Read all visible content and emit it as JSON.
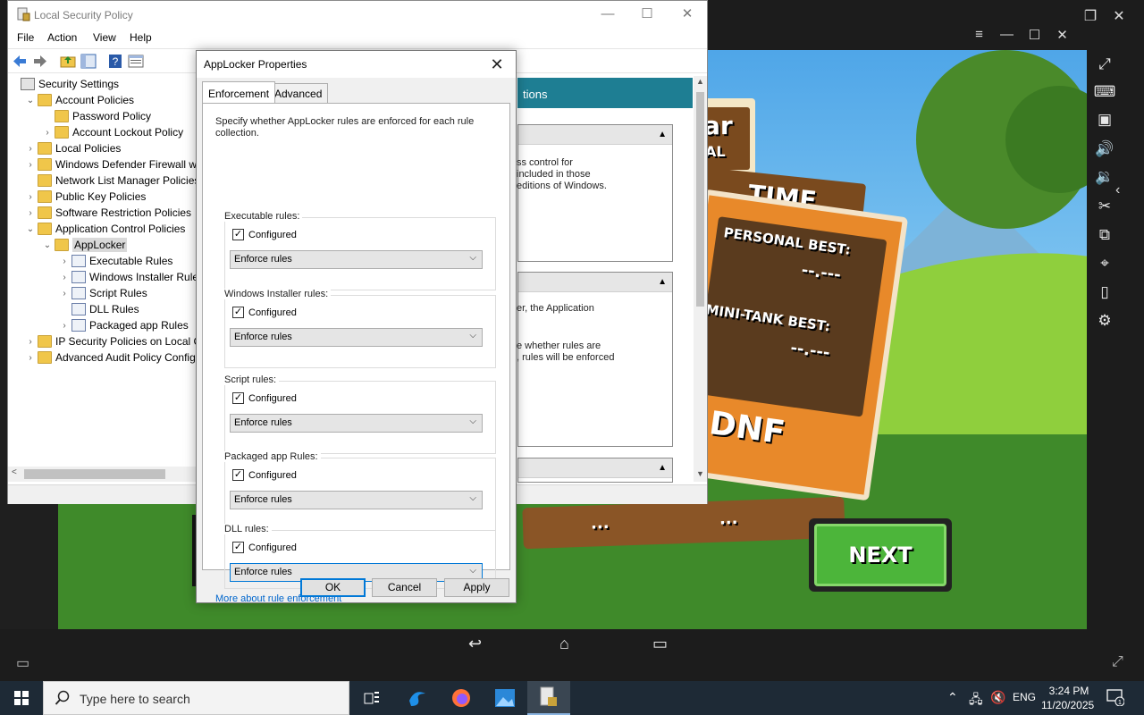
{
  "emulator": {
    "game": {
      "time_label": "TIME",
      "personal_best_label": "PERSONAL BEST:",
      "personal_best_value": "--.---",
      "mini_tank_best_label": "MINI-TANK BEST:",
      "mini_tank_best_value": "--.---",
      "result": "DNF",
      "next_label": "NEXT",
      "title_fragment_1": "ar",
      "title_fragment_2": "IAL",
      "dots": "..."
    }
  },
  "lsp": {
    "title": "Local Security Policy",
    "menu": [
      "File",
      "Action",
      "View",
      "Help"
    ],
    "tree": [
      {
        "label": "Security Settings",
        "level": 0,
        "chev": ""
      },
      {
        "label": "Account Policies",
        "level": 1,
        "chev": "v"
      },
      {
        "label": "Password Policy",
        "level": 2,
        "chev": ""
      },
      {
        "label": "Account Lockout Policy",
        "level": 2,
        "chev": ">"
      },
      {
        "label": "Local Policies",
        "level": 1,
        "chev": ">"
      },
      {
        "label": "Windows Defender Firewall with",
        "level": 1,
        "chev": ">"
      },
      {
        "label": "Network List Manager Policies",
        "level": 1,
        "chev": ""
      },
      {
        "label": "Public Key Policies",
        "level": 1,
        "chev": ">"
      },
      {
        "label": "Software Restriction Policies",
        "level": 1,
        "chev": ">"
      },
      {
        "label": "Application Control Policies",
        "level": 1,
        "chev": "v"
      },
      {
        "label": "AppLocker",
        "level": 2,
        "chev": "v"
      },
      {
        "label": "Executable Rules",
        "level": 3,
        "chev": ">"
      },
      {
        "label": "Windows Installer Rules",
        "level": 3,
        "chev": ">"
      },
      {
        "label": "Script Rules",
        "level": 3,
        "chev": ">"
      },
      {
        "label": "DLL Rules",
        "level": 3,
        "chev": ""
      },
      {
        "label": "Packaged app Rules",
        "level": 3,
        "chev": ">"
      },
      {
        "label": "IP Security Policies on Local Co",
        "level": 1,
        "chev": ">"
      },
      {
        "label": "Advanced Audit Policy Configu",
        "level": 1,
        "chev": ">"
      }
    ],
    "right_pane": {
      "header": "tions",
      "box1_lines": [
        "ss control for",
        "included in those",
        "editions of Windows."
      ],
      "box2_lines": [
        "er, the Application",
        "",
        "e whether rules are",
        ", rules will be enforced"
      ]
    }
  },
  "dialog": {
    "title": "AppLocker Properties",
    "tabs": [
      "Enforcement",
      "Advanced"
    ],
    "description": "Specify whether AppLocker rules are enforced for each rule collection.",
    "groups": [
      {
        "label": "Executable rules:",
        "checkbox": "Configured",
        "select": "Enforce rules"
      },
      {
        "label": "Windows Installer rules:",
        "checkbox": "Configured",
        "select": "Enforce rules"
      },
      {
        "label": "Script rules:",
        "checkbox": "Configured",
        "select": "Enforce rules"
      },
      {
        "label": "Packaged app Rules:",
        "checkbox": "Configured",
        "select": "Enforce rules"
      },
      {
        "label": "DLL rules:",
        "checkbox": "Configured",
        "select": "Enforce rules"
      }
    ],
    "more_link": "More about rule enforcement",
    "ok": "OK",
    "cancel": "Cancel",
    "apply": "Apply"
  },
  "taskbar": {
    "search_placeholder": "Type here to search",
    "language": "ENG",
    "time": "3:24 PM",
    "date": "11/20/2025",
    "notification_count": "1"
  }
}
